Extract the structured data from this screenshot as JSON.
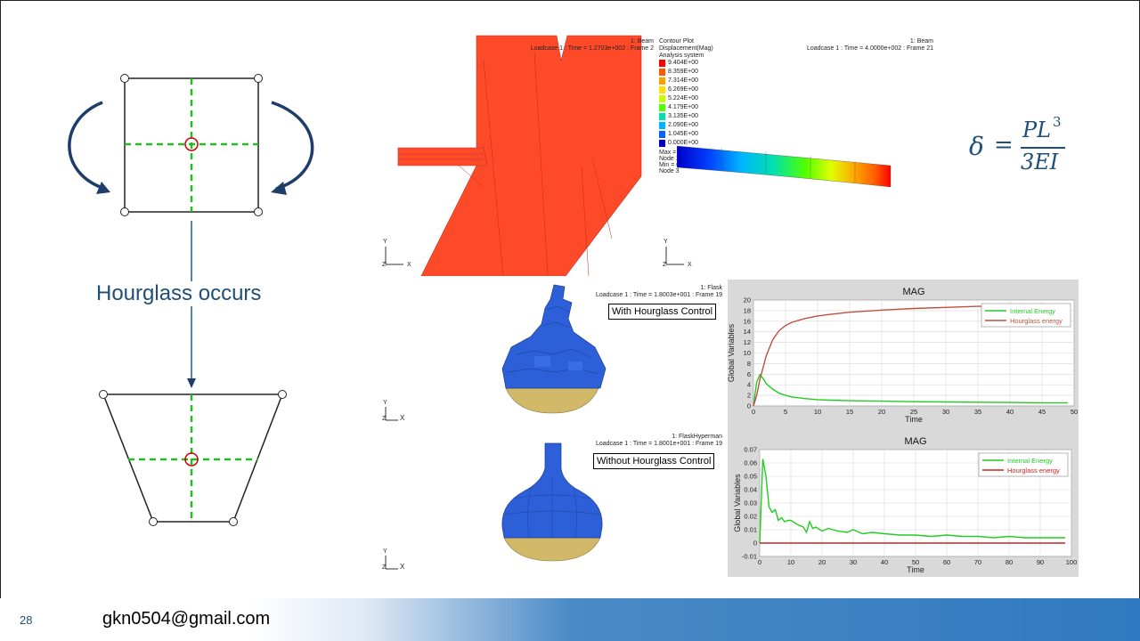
{
  "left_diagram": {
    "caption": "Hourglass occurs"
  },
  "formula": {
    "lhs": "δ",
    "equals": "=",
    "numerator": "PL",
    "numerator_exp": "3",
    "denominator": "3EI"
  },
  "beam_view_left": {
    "header_title": "1: Beam",
    "header_line": "Loadcase 1 : Time = 1.2703e+002 : Frame 2",
    "axis_y": "Y",
    "axis_x": "X",
    "axis_z": "Z"
  },
  "contour": {
    "title": "Contour Plot",
    "subtitle": "Displacement(Mag)",
    "system": "Analysis system",
    "levels": [
      "9.404E+00",
      "8.359E+00",
      "7.314E+00",
      "6.269E+00",
      "5.224E+00",
      "4.179E+00",
      "3.135E+00",
      "2.090E+00",
      "1.045E+00",
      "0.000E+00"
    ],
    "colors": [
      "#ff0000",
      "#ff5a00",
      "#ffa000",
      "#ffe000",
      "#c8ff00",
      "#50ff00",
      "#00e0b0",
      "#00b4ff",
      "#0064ff",
      "#0000c8"
    ],
    "max_line": "Max = ",
    "node_line1": "Node 1",
    "min_line": "Min = 0",
    "node_line2": "Node 3"
  },
  "beam_view_right": {
    "header_title": "1: Beam",
    "header_line": "Loadcase 1 : Time = 4.0000e+002 : Frame 21",
    "axis_y": "Y",
    "axis_x": "X",
    "axis_z": "Z"
  },
  "flask_with": {
    "header_title": "1: Flask",
    "header_line": "Loadcase 1 : Time = 1.8003e+001 : Frame 19",
    "label": "With Hourglass Control",
    "axis_y": "Y",
    "axis_x": "X",
    "axis_z": "Z"
  },
  "flask_without": {
    "header_title": "1: FlaskHyperman",
    "header_line": "Loadcase 1 : Time = 1.8001e+001 : Frame 19",
    "label": "Without Hourglass Control",
    "axis_y": "Y",
    "axis_x": "X",
    "axis_z": "Z"
  },
  "chart_data": [
    {
      "type": "line",
      "title": "MAG",
      "xlabel": "Time",
      "ylabel": "Global Variables",
      "xlim": [
        0,
        50
      ],
      "ylim": [
        0,
        20
      ],
      "xticks": [
        "0",
        "5",
        "10",
        "15",
        "20",
        "25",
        "30",
        "35",
        "40",
        "45",
        "50"
      ],
      "yticks": [
        "0",
        "2",
        "4",
        "6",
        "8",
        "10",
        "12",
        "14",
        "16",
        "18",
        "20"
      ],
      "grid": true,
      "legend_position": "top-right",
      "series": [
        {
          "name": "Internal Energy",
          "color": "#22cc22",
          "x": [
            0,
            0.5,
            1,
            1.5,
            2,
            3,
            4,
            5,
            6,
            8,
            10,
            12,
            15,
            20,
            25,
            30,
            35,
            40,
            45,
            49
          ],
          "y": [
            0,
            4.5,
            5.9,
            5.2,
            4.2,
            3.2,
            2.4,
            2.0,
            1.7,
            1.4,
            1.2,
            1.1,
            1.0,
            0.9,
            0.8,
            0.75,
            0.7,
            0.65,
            0.6,
            0.6
          ]
        },
        {
          "name": "Hourglass energy",
          "color": "#c0503c",
          "x": [
            0,
            0.5,
            1,
            2,
            3,
            4,
            5,
            6,
            8,
            10,
            12,
            15,
            20,
            25,
            30,
            35,
            37
          ],
          "y": [
            0,
            2.0,
            5.0,
            9.5,
            12.5,
            14.2,
            15.2,
            15.8,
            16.5,
            17.0,
            17.3,
            17.7,
            18.1,
            18.4,
            18.6,
            18.8,
            18.8
          ]
        }
      ]
    },
    {
      "type": "line",
      "title": "MAG",
      "xlabel": "Time",
      "ylabel": "Global Variables",
      "xlim": [
        0,
        100
      ],
      "ylim": [
        -0.01,
        0.07
      ],
      "xticks": [
        "0",
        "10",
        "20",
        "30",
        "40",
        "50",
        "60",
        "70",
        "80",
        "90",
        "100"
      ],
      "yticks": [
        "-0.01",
        "0",
        "0.01",
        "0.02",
        "0.03",
        "0.04",
        "0.05",
        "0.06",
        "0.07"
      ],
      "grid": true,
      "legend_position": "top-right",
      "series": [
        {
          "name": "Internal Energy",
          "color": "#22cc22",
          "x": [
            0,
            1,
            2,
            3,
            4,
            5,
            6,
            7,
            8,
            9,
            10,
            12,
            14,
            15,
            16,
            17,
            18,
            20,
            22,
            25,
            28,
            30,
            33,
            36,
            40,
            45,
            50,
            55,
            60,
            65,
            70,
            75,
            80,
            85,
            90,
            95,
            98
          ],
          "y": [
            0,
            0.063,
            0.05,
            0.027,
            0.023,
            0.025,
            0.017,
            0.019,
            0.016,
            0.017,
            0.017,
            0.014,
            0.012,
            0.008,
            0.016,
            0.011,
            0.012,
            0.009,
            0.011,
            0.009,
            0.008,
            0.01,
            0.007,
            0.008,
            0.007,
            0.006,
            0.006,
            0.005,
            0.006,
            0.005,
            0.005,
            0.004,
            0.005,
            0.004,
            0.004,
            0.004,
            0.004
          ]
        },
        {
          "name": "Hourglass energy",
          "color": "#cc2222",
          "x": [
            0,
            98
          ],
          "y": [
            0,
            0
          ]
        }
      ]
    }
  ],
  "footer": {
    "page_number": "28",
    "email": "gkn0504@gmail.com"
  }
}
